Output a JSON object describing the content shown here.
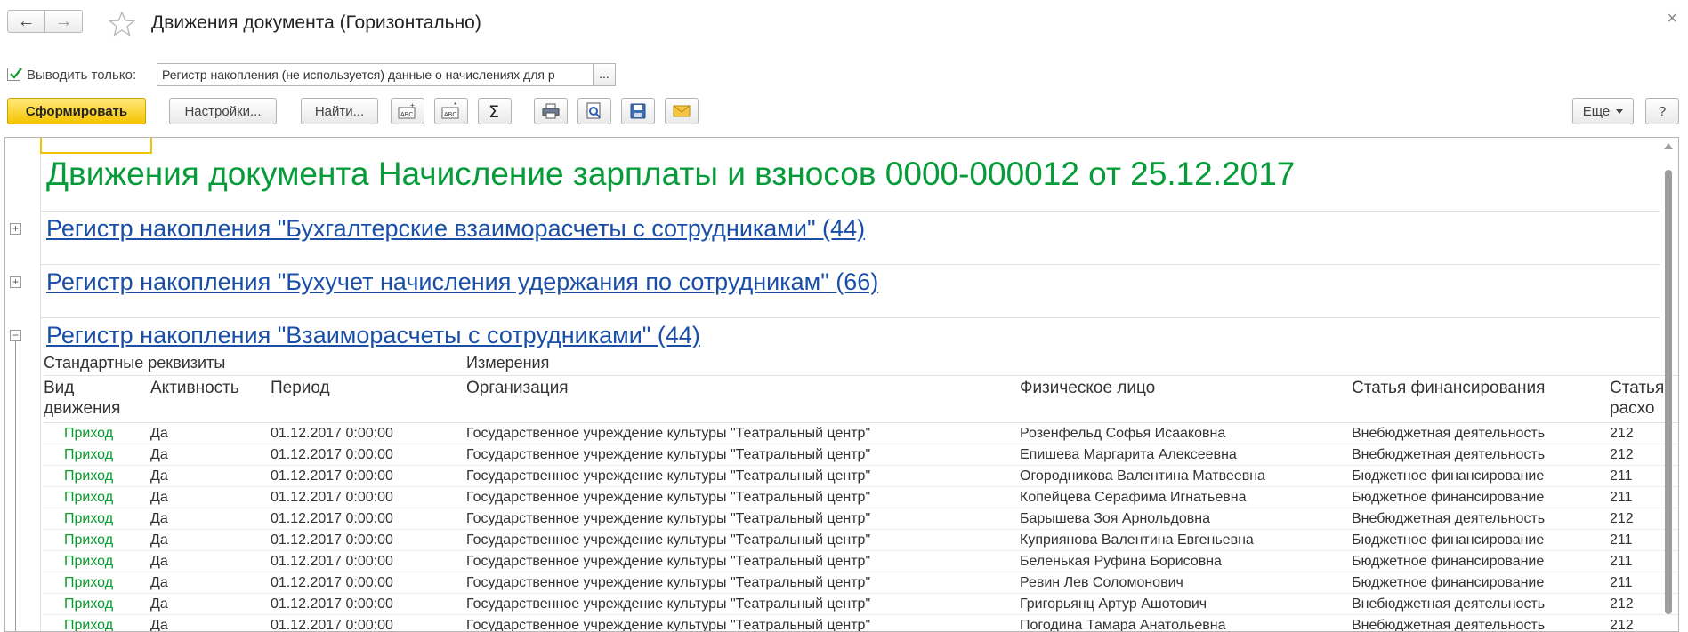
{
  "window": {
    "title": "Движения документа (Горизонтально)",
    "back_glyph": "←",
    "forward_glyph": "→",
    "close_glyph": "×"
  },
  "filter": {
    "checkbox_checked": true,
    "label": "Выводить только:",
    "value": "Регистр накопления (не используется) данные о начислениях для р",
    "more_label": "..."
  },
  "toolbar": {
    "generate_label": "Сформировать",
    "settings_label": "Настройки...",
    "find_label": "Найти...",
    "more_label": "Еще",
    "help_label": "?",
    "icons": [
      "expand-abc-icon",
      "collapse-abc-icon",
      "sum-icon",
      "print-icon",
      "preview-icon",
      "save-icon",
      "mail-icon"
    ]
  },
  "report": {
    "title": "Движения документа Начисление зарплаты и взносов 0000-000012 от 25.12.2017",
    "registers": [
      {
        "label": "Регистр накопления \"Бухгалтерские взаиморасчеты с сотрудниками\" (44)",
        "expanded": false
      },
      {
        "label": "Регистр накопления \"Бухучет начисления удержания по сотрудникам\" (66)",
        "expanded": false
      },
      {
        "label": "Регистр накопления \"Взаиморасчеты с сотрудниками\" (44)",
        "expanded": true
      }
    ],
    "toggle_plus": "+",
    "toggle_minus": "−",
    "colors": {
      "title": "#079c3a",
      "link": "#1a4fa8",
      "movement": "#0a9b2e",
      "primary_button": "#f5c400"
    }
  },
  "table": {
    "group_headers": [
      "Стандартные реквизиты",
      "Измерения"
    ],
    "columns": [
      "Вид движения",
      "Активность",
      "Период",
      "Организация",
      "Физическое лицо",
      "Статья финансирования",
      "Статья расхо"
    ],
    "rows": [
      [
        "Приход",
        "Да",
        "01.12.2017 0:00:00",
        "Государственное учреждение культуры \"Театральный центр\"",
        "Розенфельд Софья Исааковна",
        "Внебюджетная деятельность",
        "212"
      ],
      [
        "Приход",
        "Да",
        "01.12.2017 0:00:00",
        "Государственное учреждение культуры \"Театральный центр\"",
        "Епишева Маргарита Алексеевна",
        "Внебюджетная деятельность",
        "212"
      ],
      [
        "Приход",
        "Да",
        "01.12.2017 0:00:00",
        "Государственное учреждение культуры \"Театральный центр\"",
        "Огородникова Валентина Матвеевна",
        "Бюджетное финансирование",
        "211"
      ],
      [
        "Приход",
        "Да",
        "01.12.2017 0:00:00",
        "Государственное учреждение культуры \"Театральный центр\"",
        "Копейцева Серафима Игнатьевна",
        "Бюджетное финансирование",
        "211"
      ],
      [
        "Приход",
        "Да",
        "01.12.2017 0:00:00",
        "Государственное учреждение культуры \"Театральный центр\"",
        "Барышева Зоя Арнольдовна",
        "Внебюджетная деятельность",
        "212"
      ],
      [
        "Приход",
        "Да",
        "01.12.2017 0:00:00",
        "Государственное учреждение культуры \"Театральный центр\"",
        "Куприянова Валентина Евгеньевна",
        "Бюджетное финансирование",
        "211"
      ],
      [
        "Приход",
        "Да",
        "01.12.2017 0:00:00",
        "Государственное учреждение культуры \"Театральный центр\"",
        "Беленькая Руфина Борисовна",
        "Бюджетное финансирование",
        "211"
      ],
      [
        "Приход",
        "Да",
        "01.12.2017 0:00:00",
        "Государственное учреждение культуры \"Театральный центр\"",
        "Ревин Лев Соломонович",
        "Бюджетное финансирование",
        "211"
      ],
      [
        "Приход",
        "Да",
        "01.12.2017 0:00:00",
        "Государственное учреждение культуры \"Театральный центр\"",
        "Григорьянц Артур Ашотович",
        "Внебюджетная деятельность",
        "212"
      ],
      [
        "Приход",
        "Да",
        "01.12.2017 0:00:00",
        "Государственное учреждение культуры \"Театральный центр\"",
        "Погодина Тамара Анатольевна",
        "Внебюджетная деятельность",
        "212"
      ]
    ]
  }
}
